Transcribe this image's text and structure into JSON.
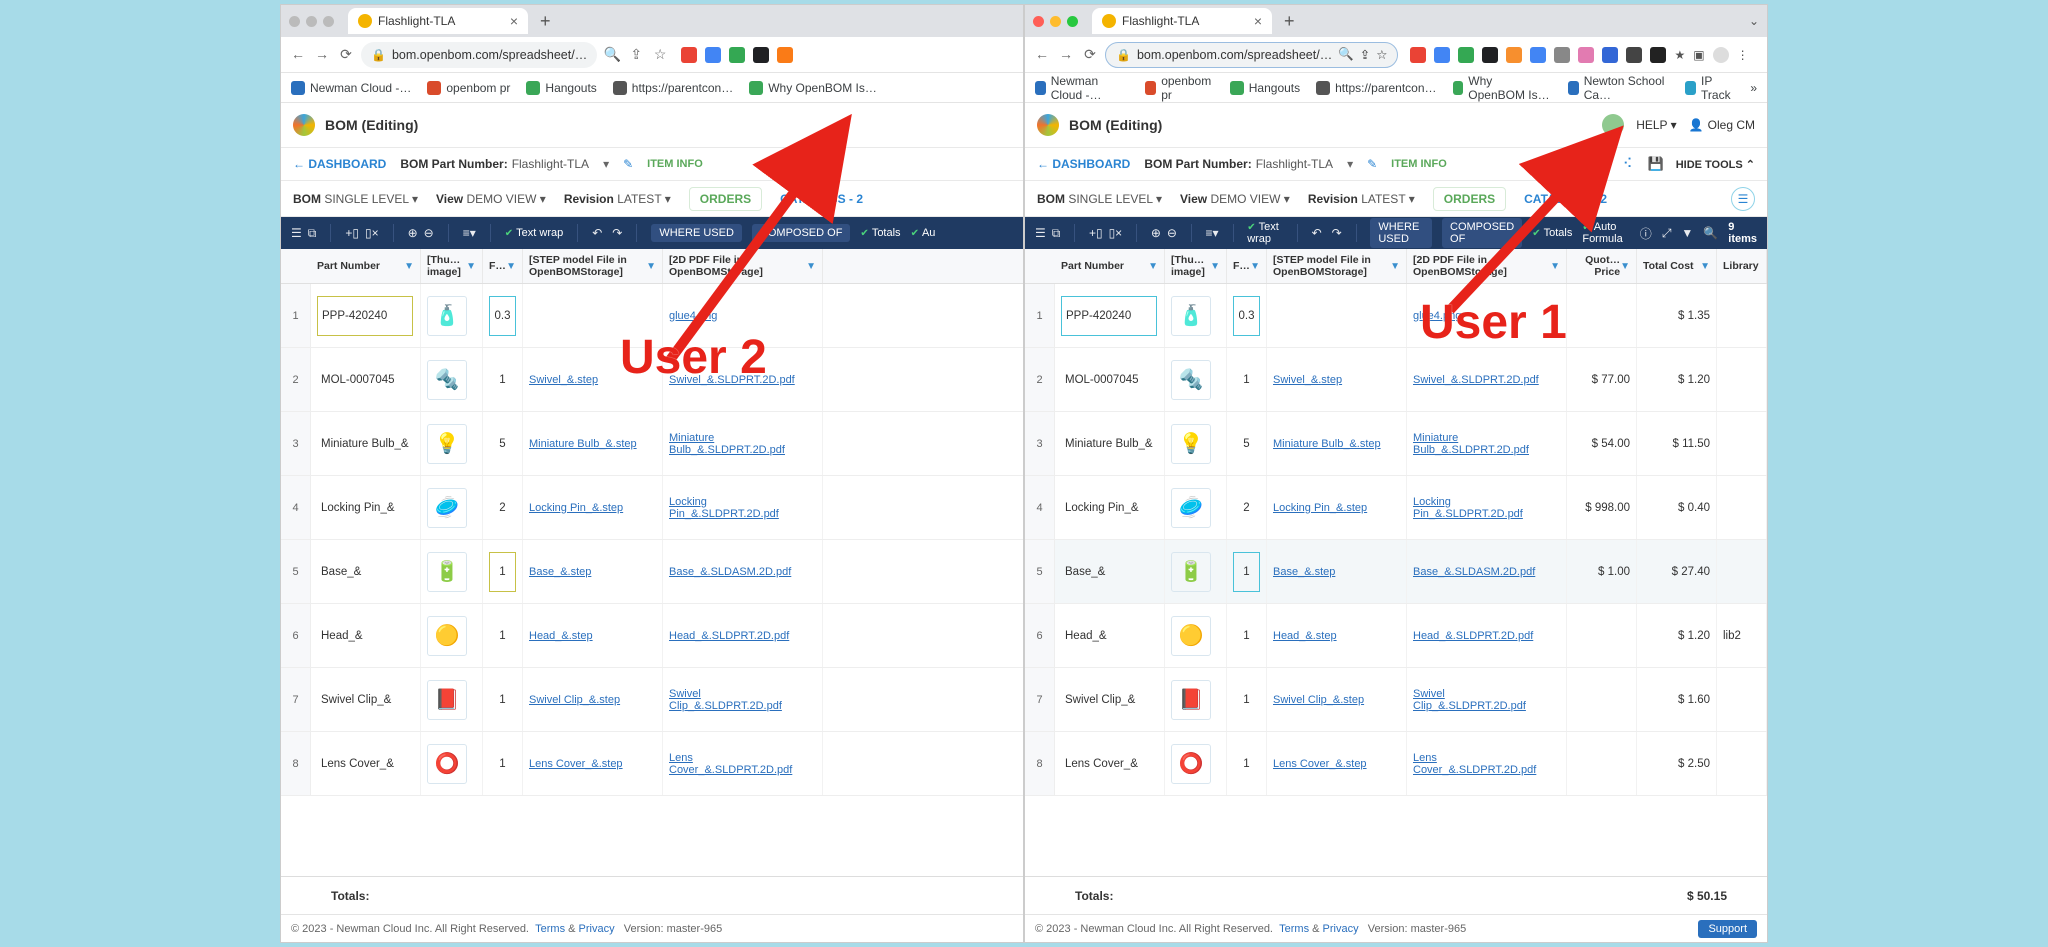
{
  "browser": {
    "tab_title": "Flashlight-TLA",
    "url_display": "bom.openbom.com/spreadsheet/…",
    "bookmarks": [
      {
        "label": "Newman Cloud -…",
        "color": "#2a6fbd"
      },
      {
        "label": "openbom pr",
        "color": "#d94b2b"
      },
      {
        "label": "Hangouts",
        "color": "#3aa757"
      },
      {
        "label": "https://parentcon…",
        "color": "#555"
      },
      {
        "label": "Why OpenBOM Is…",
        "color": "#3aa757"
      }
    ],
    "bookmarks_right": [
      {
        "label": "Newton School Ca…",
        "color": "#2a6fbd"
      },
      {
        "label": "IP Track",
        "color": "#2aa0c8"
      }
    ]
  },
  "annotations": {
    "user1": "User 1",
    "user2": "User 2"
  },
  "left": {
    "app_title": "BOM (Editing)",
    "dashboard": "DASHBOARD",
    "bom_part_label": "BOM Part Number:",
    "bom_part_value": "Flashlight-TLA",
    "item_info": "ITEM INFO",
    "bom_label": "BOM",
    "bom_val": "SINGLE LEVEL",
    "view_label": "View",
    "view_val": "DEMO VIEW",
    "rev_label": "Revision",
    "rev_val": "LATEST",
    "orders": "ORDERS",
    "catalogs": "CATALOGS - 2",
    "dark": {
      "text_wrap": "Text wrap",
      "where_used": "WHERE USED",
      "composed": "COMPOSED OF",
      "totals": "Totals",
      "auto": "Au"
    },
    "columns": [
      "Part Number",
      "[Thu… image]",
      "F…",
      "[STEP model File in OpenBOMStorage]",
      "[2D PDF File in OpenBOMStorage]"
    ],
    "rows": [
      {
        "n": 1,
        "pn": "PPP-420240",
        "f": "0.3",
        "step": "",
        "pdf": "glue4.png",
        "icon": "🧴",
        "pnboxClass": "outlined-olive",
        "fboxClass": "outlined-cyan"
      },
      {
        "n": 2,
        "pn": "MOL-0007045",
        "f": "1",
        "step": "Swivel_&.step",
        "pdf": "Swivel_&.SLDPRT.2D.pdf",
        "icon": "🔩"
      },
      {
        "n": 3,
        "pn": "Miniature Bulb_&",
        "f": "5",
        "step": "Miniature Bulb_&.step",
        "pdf": "Miniature Bulb_&.SLDPRT.2D.pdf",
        "icon": "💡"
      },
      {
        "n": 4,
        "pn": "Locking Pin_&",
        "f": "2",
        "step": "Locking Pin_&.step",
        "pdf": "Locking Pin_&.SLDPRT.2D.pdf",
        "icon": "🥏"
      },
      {
        "n": 5,
        "pn": "Base_&",
        "f": "1",
        "step": "Base_&.step",
        "pdf": "Base_&.SLDASM.2D.pdf",
        "icon": "🔋",
        "fboxClass": "outlined-olive"
      },
      {
        "n": 6,
        "pn": "Head_&",
        "f": "1",
        "step": "Head_&.step",
        "pdf": "Head_&.SLDPRT.2D.pdf",
        "icon": "🟡"
      },
      {
        "n": 7,
        "pn": "Swivel Clip_&",
        "f": "1",
        "step": "Swivel Clip_&.step",
        "pdf": "Swivel Clip_&.SLDPRT.2D.pdf",
        "icon": "📕"
      },
      {
        "n": 8,
        "pn": "Lens Cover_&",
        "f": "1",
        "step": "Lens Cover_&.step",
        "pdf": "Lens Cover_&.SLDPRT.2D.pdf",
        "icon": "⭕"
      }
    ],
    "totals_label": "Totals:"
  },
  "right": {
    "app_title": "BOM (Editing)",
    "help": "HELP",
    "user_name": "Oleg CM",
    "dashboard": "DASHBOARD",
    "bom_part_label": "BOM Part Number:",
    "bom_part_value": "Flashlight-TLA",
    "item_info": "ITEM INFO",
    "hide_tools": "HIDE TOOLS",
    "bom_label": "BOM",
    "bom_val": "SINGLE LEVEL",
    "view_label": "View",
    "view_val": "DEMO VIEW",
    "rev_label": "Revision",
    "rev_val": "LATEST",
    "orders": "ORDERS",
    "catalogs": "CATALOGS - 2",
    "dark": {
      "text_wrap": "Text wrap",
      "where_used": "WHERE USED",
      "composed": "COMPOSED OF",
      "totals": "Totals",
      "auto": "Auto Formula",
      "items": "9 items"
    },
    "columns": [
      "Part Number",
      "[Thu… image]",
      "F…",
      "[STEP model File in OpenBOMStorage]",
      "[2D PDF File in OpenBOMStorage]",
      "Quot… Price",
      "Total Cost",
      "Library"
    ],
    "rows": [
      {
        "n": 1,
        "pn": "PPP-420240",
        "f": "0.3",
        "step": "",
        "pdf": "glue4.png",
        "price": "",
        "cost": "$ 1.35",
        "lib": "",
        "icon": "🧴",
        "pnboxClass": "outlined-cyan",
        "fboxClass": "outlined-cyan"
      },
      {
        "n": 2,
        "pn": "MOL-0007045",
        "f": "1",
        "step": "Swivel_&.step",
        "pdf": "Swivel_&.SLDPRT.2D.pdf",
        "price": "$ 77.00",
        "cost": "$ 1.20",
        "lib": "",
        "icon": "🔩"
      },
      {
        "n": 3,
        "pn": "Miniature Bulb_&",
        "f": "5",
        "step": "Miniature Bulb_&.step",
        "pdf": "Miniature Bulb_&.SLDPRT.2D.pdf",
        "price": "$ 54.00",
        "cost": "$ 11.50",
        "lib": "",
        "icon": "💡"
      },
      {
        "n": 4,
        "pn": "Locking Pin_&",
        "f": "2",
        "step": "Locking Pin_&.step",
        "pdf": "Locking Pin_&.SLDPRT.2D.pdf",
        "price": "$ 998.00",
        "cost": "$ 0.40",
        "lib": "",
        "icon": "🥏"
      },
      {
        "n": 5,
        "pn": "Base_&",
        "f": "1",
        "step": "Base_&.step",
        "pdf": "Base_&.SLDASM.2D.pdf",
        "price": "$ 1.00",
        "cost": "$ 27.40",
        "lib": "",
        "icon": "🔋",
        "fboxClass": "outlined-cyan",
        "rowSel": true
      },
      {
        "n": 6,
        "pn": "Head_&",
        "f": "1",
        "step": "Head_&.step",
        "pdf": "Head_&.SLDPRT.2D.pdf",
        "price": "",
        "cost": "$ 1.20",
        "lib": "lib2",
        "icon": "🟡"
      },
      {
        "n": 7,
        "pn": "Swivel Clip_&",
        "f": "1",
        "step": "Swivel Clip_&.step",
        "pdf": "Swivel Clip_&.SLDPRT.2D.pdf",
        "price": "",
        "cost": "$ 1.60",
        "lib": "",
        "icon": "📕"
      },
      {
        "n": 8,
        "pn": "Lens Cover_&",
        "f": "1",
        "step": "Lens Cover_&.step",
        "pdf": "Lens Cover_&.SLDPRT.2D.pdf",
        "price": "",
        "cost": "$ 2.50",
        "lib": "",
        "icon": "⭕"
      }
    ],
    "totals_label": "Totals:",
    "totals_value": "$ 50.15"
  },
  "footer": {
    "copyright": "© 2023 - Newman Cloud Inc. All Right Reserved.",
    "terms": "Terms",
    "and": "&",
    "privacy": "Privacy",
    "version": "Version: master-965",
    "support": "Support"
  }
}
